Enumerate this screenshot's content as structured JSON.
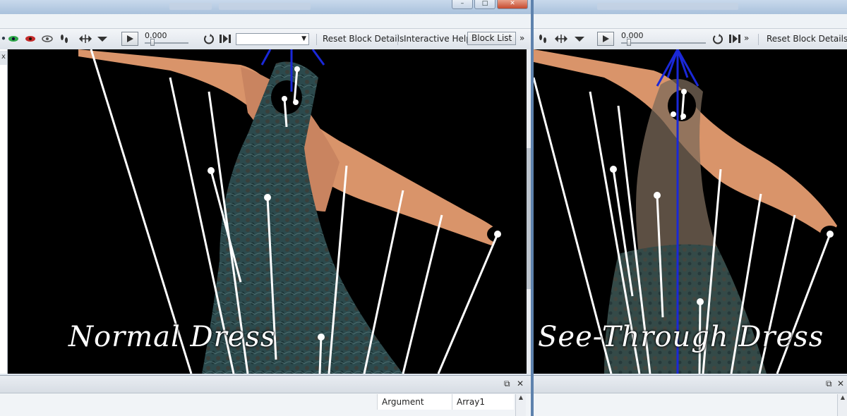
{
  "left": {
    "time_value": "0.000",
    "reset_label": "Reset Block Details",
    "help_label": "Interactive Help",
    "block_list_label": "Block List",
    "more_label": "»",
    "caption": "Normal Dress",
    "panel_tab_label": "x",
    "columns": [
      "Argument",
      "Array1"
    ],
    "close_label": "✕",
    "restore_label": "⧉"
  },
  "right": {
    "time_value": "0.000",
    "reset_label": "Reset Block Details",
    "more_label": "»",
    "caption": "See-Through Dress",
    "close_label": "✕",
    "restore_label": "⧉"
  },
  "titlebar": {
    "minimize": "–",
    "maximize": "□",
    "close": "✕"
  },
  "icons": {
    "green_eye": "eye-green-icon",
    "red_eye": "eye-red-icon",
    "grey_eye": "eye-grey-icon",
    "footprints": "footprints-icon",
    "move": "move-icon",
    "dropdown": "chevron-down-icon",
    "play": "play-icon",
    "loop": "loop-icon",
    "step": "step-icon"
  },
  "colors": {
    "viewport_bg": "#000000",
    "skin": "#d9946a",
    "dress": "#2c4a4d",
    "guide_line": "#ffffff",
    "bone_blue": "#1a28d8"
  }
}
